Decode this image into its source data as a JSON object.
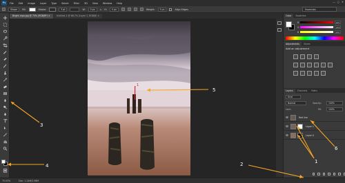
{
  "app": {
    "logo": "Ps",
    "menu": [
      "File",
      "Edit",
      "Image",
      "Layer",
      "Type",
      "Select",
      "Filter",
      "3D",
      "View",
      "Window",
      "Help"
    ]
  },
  "window_controls": [
    "—",
    "▢",
    "✕"
  ],
  "options_bar": {
    "shape_mode": "Shape",
    "fill_label": "Fill:",
    "stroke_label": "Stroke:",
    "stroke_width": "3 pt",
    "w_label": "W:",
    "w_value": "0 px",
    "h_label": "H:",
    "h_value": "0 px",
    "weight_label": "Weight:",
    "weight_value": "5 px",
    "align_edges_label": "Align Edges",
    "workspace": "Essentials"
  },
  "tabs": [
    {
      "label": "Bright.mpo.jpg @ 75% (RGB/8*) ×",
      "active": true
    },
    {
      "label": "Untitled-1 @ 66.7% (Layer 1, RGB/8) ×",
      "active": false
    }
  ],
  "status_bar": {
    "zoom": "75.03%",
    "doc_size": "Doc: 1.24M/2.98M"
  },
  "color_panel": {
    "tabs": [
      "Color",
      "Swatches"
    ],
    "sliders": [
      {
        "label": "R",
        "value": "255",
        "gradient": [
          "#000000",
          "#ff0000"
        ]
      },
      {
        "label": "G",
        "value": "255",
        "gradient": [
          "#ff00ff",
          "#ffffff"
        ]
      },
      {
        "label": "B",
        "value": "255",
        "gradient": [
          "#ffff00",
          "#ffffff"
        ]
      }
    ]
  },
  "adjustments_panel": {
    "tabs": [
      "Adjustments",
      "Styles"
    ],
    "title": "Add an adjustment"
  },
  "layers_panel": {
    "tabs": [
      "Layers",
      "Channels",
      "Paths"
    ],
    "kind_filter": "Kind",
    "blend_mode": "Normal",
    "opacity_label": "Opacity:",
    "opacity_value": "100%",
    "lock_label": "Lock:",
    "fill_label": "Fill:",
    "fill_value": "100%",
    "layers": [
      {
        "name": "Red line"
      },
      {
        "name": "Layer 1"
      },
      {
        "name": "Layer 0"
      }
    ]
  },
  "annotations": [
    "1",
    "2",
    "3",
    "4",
    "5",
    "6"
  ],
  "colors": {
    "accent_annotation": "#f5a623",
    "canvas_bg": "#252525",
    "panel_bg": "#3a3a3a"
  }
}
